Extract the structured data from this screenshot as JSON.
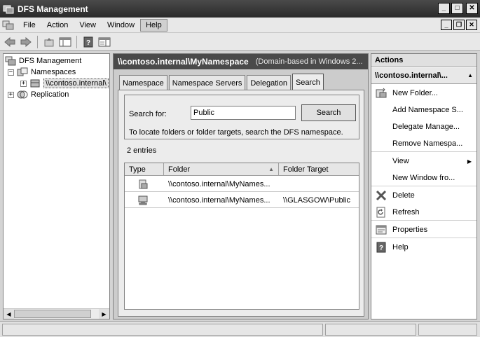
{
  "window": {
    "title": "DFS Management"
  },
  "menu": {
    "items": [
      "File",
      "Action",
      "View",
      "Window",
      "Help"
    ]
  },
  "tree": {
    "root": "DFS Management",
    "namespaces": "Namespaces",
    "namespace_item": "\\\\contoso.internal\\",
    "replication": "Replication"
  },
  "center": {
    "namespace": "\\\\contoso.internal\\MyNamespace",
    "description": "(Domain-based in Windows 2...",
    "tabs": [
      "Namespace",
      "Namespace Servers",
      "Delegation",
      "Search"
    ],
    "active_tab": "Search",
    "search": {
      "label": "Search for:",
      "value": "Public",
      "button": "Search",
      "hint": "To locate folders or folder targets, search the DFS namespace."
    },
    "entries_count": "2 entries",
    "table": {
      "columns": [
        "Type",
        "Folder",
        "Folder Target"
      ],
      "rows": [
        {
          "type_icon": "folder-icon",
          "folder": "\\\\contoso.internal\\MyNames...",
          "target": ""
        },
        {
          "type_icon": "folder-target-icon",
          "folder": "\\\\contoso.internal\\MyNames...",
          "target": "\\\\GLASGOW\\Public"
        }
      ]
    }
  },
  "actions": {
    "header": "Actions",
    "context": "\\\\contoso.internal\\...",
    "items": [
      {
        "label": "New Folder...",
        "icon": "new-folder-icon"
      },
      {
        "label": "Add Namespace S...",
        "icon": ""
      },
      {
        "label": "Delegate Manage...",
        "icon": ""
      },
      {
        "label": "Remove Namespa...",
        "icon": ""
      },
      {
        "label": "View",
        "icon": ""
      },
      {
        "label": "New Window fro...",
        "icon": ""
      },
      {
        "label": "Delete",
        "icon": "delete-icon"
      },
      {
        "label": "Refresh",
        "icon": "refresh-icon"
      },
      {
        "label": "Properties",
        "icon": "properties-icon"
      },
      {
        "label": "Help",
        "icon": "help-icon"
      }
    ]
  }
}
